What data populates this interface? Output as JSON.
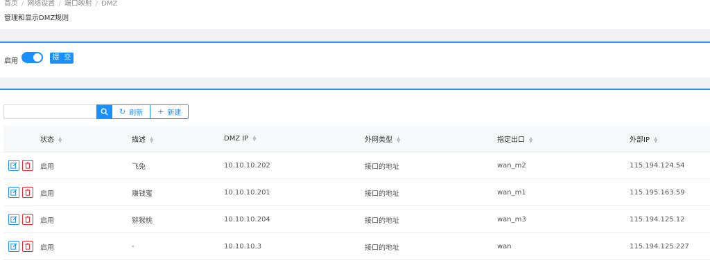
{
  "breadcrumb": {
    "items": [
      "首页",
      "网络设置",
      "端口映射",
      "DMZ"
    ]
  },
  "page": {
    "description": "管理和显示DMZ规则"
  },
  "settings": {
    "enable_label": "启用",
    "enabled": true,
    "submit_label": "提 交"
  },
  "toolbar": {
    "search_value": "",
    "refresh_label": "刷新",
    "new_label": "新建"
  },
  "table": {
    "columns": [
      "状态",
      "描述",
      "DMZ IP",
      "外网类型",
      "指定出口",
      "外部IP"
    ],
    "rows": [
      {
        "status": "启用",
        "desc": "飞兔",
        "dmz_ip": "10.10.10.202",
        "wan_type": "接口的地址",
        "outlet": "wan_m2",
        "ext_ip": "115.194.124.54"
      },
      {
        "status": "启用",
        "desc": "赚钱蜜",
        "dmz_ip": "10.10.10.201",
        "wan_type": "接口的地址",
        "outlet": "wan_m1",
        "ext_ip": "115.195.163.59"
      },
      {
        "status": "启用",
        "desc": "猕猴桃",
        "dmz_ip": "10.10.10.204",
        "wan_type": "接口的地址",
        "outlet": "wan_m3",
        "ext_ip": "115.194.125.12"
      },
      {
        "status": "启用",
        "desc": "-",
        "dmz_ip": "10.10.10.3",
        "wan_type": "接口的地址",
        "outlet": "wan",
        "ext_ip": "115.194.125.227"
      }
    ]
  },
  "colors": {
    "primary": "#1890ff",
    "accent_line": "#2d8cf0",
    "danger": "#f5222d",
    "band": "#f0f1f5"
  }
}
